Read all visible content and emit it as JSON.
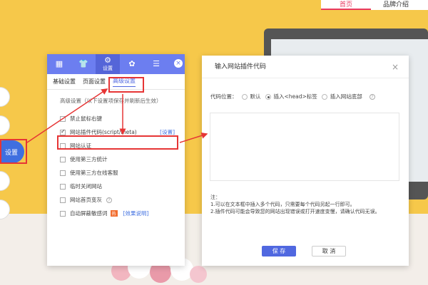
{
  "top_nav": {
    "items": [
      {
        "label": "首页"
      },
      {
        "label": "品牌介绍"
      }
    ]
  },
  "left_button": {
    "label": "设置"
  },
  "panel": {
    "header_items": [
      {
        "icon": "grid-icon",
        "label": ""
      },
      {
        "icon": "shirt-icon",
        "label": ""
      },
      {
        "icon": "gear-icon",
        "label": "设置"
      },
      {
        "icon": "paw-icon",
        "label": ""
      },
      {
        "icon": "layers-icon",
        "label": ""
      }
    ],
    "tabs": [
      {
        "label": "基础设置"
      },
      {
        "label": "页面设置"
      },
      {
        "label": "高级设置"
      }
    ],
    "note": "高级设置（以下设置项保存并刷新后生效）",
    "options": [
      {
        "label": "禁止鼠标右键",
        "checked": false
      },
      {
        "label": "网站插件代码(script/meta)",
        "checked": true,
        "link": "[设置]"
      },
      {
        "label": "网站认证",
        "checked": false
      },
      {
        "label": "使用第三方统计",
        "checked": false
      },
      {
        "label": "使用第三方在线客服",
        "checked": false
      },
      {
        "label": "临时关闭网站",
        "checked": false
      },
      {
        "label": "网站首页变灰",
        "checked": false,
        "help": "?"
      },
      {
        "label": "自动屏蔽敏感词",
        "checked": false,
        "badge": "热",
        "link": "[效果说明]"
      }
    ]
  },
  "modal": {
    "title": "输入网站插件代码",
    "close": "×",
    "code_position_label": "代码位置：",
    "radio_options": [
      {
        "label": "默认",
        "checked": false
      },
      {
        "label": "插入<head>标签",
        "checked": true
      },
      {
        "label": "插入网站底部",
        "checked": false
      }
    ],
    "help": "?",
    "note_title": "注：",
    "note_lines": [
      "1.可以在文本框中插入多个代码，只需要每个代码另起一行即可。",
      "2.插件代码可能会导致您的网站出现错误或打开速度变慢，请确认代码无误。"
    ],
    "save_label": "保 存",
    "cancel_label": "取 消"
  },
  "colors": {
    "accent": "#5068e0",
    "header": "#6c7ef0",
    "annotation": "#e63535",
    "background": "#f6c84a"
  }
}
